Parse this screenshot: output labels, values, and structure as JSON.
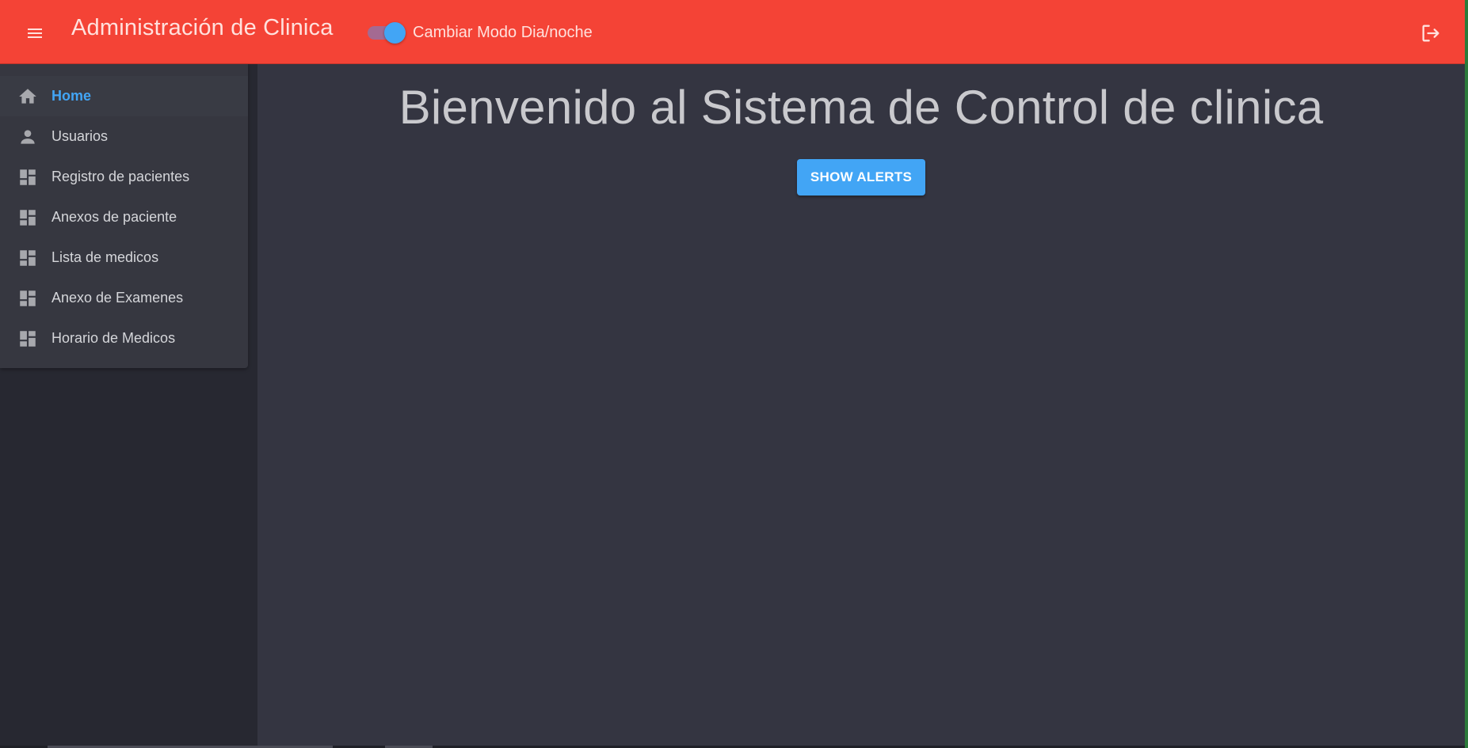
{
  "header": {
    "title": "Administración de Clinica",
    "toggle_label": "Cambiar Modo Dia/noche",
    "toggle_on": true,
    "menu_icon": "menu-icon",
    "logout_icon": "logout-icon",
    "color": "#f44336"
  },
  "sidebar": {
    "items": [
      {
        "label": "Home",
        "icon": "home-icon",
        "active": true
      },
      {
        "label": "Usuarios",
        "icon": "person-icon",
        "active": false
      },
      {
        "label": "Registro de pacientes",
        "icon": "dashboard-icon",
        "active": false
      },
      {
        "label": "Anexos de paciente",
        "icon": "dashboard-icon",
        "active": false
      },
      {
        "label": "Lista de medicos",
        "icon": "dashboard-icon",
        "active": false
      },
      {
        "label": "Anexo de Examenes",
        "icon": "dashboard-icon",
        "active": false
      },
      {
        "label": "Horario de Medicos",
        "icon": "dashboard-icon",
        "active": false
      }
    ]
  },
  "main": {
    "heading": "Bienvenido al Sistema de Control de clinica",
    "alerts_button": "SHOW ALERTS",
    "accent": "#42a5f5"
  }
}
